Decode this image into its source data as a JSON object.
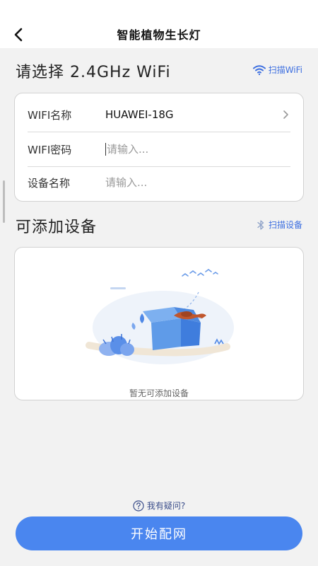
{
  "header": {
    "title": "智能植物生长灯"
  },
  "wifi_section": {
    "title": "请选择 2.4GHz WiFi",
    "scan_label": "扫描WiFi"
  },
  "form": {
    "wifi_name_label": "WIFI名称",
    "wifi_name_value": "HUAWEI-18G",
    "wifi_password_label": "WIFI密码",
    "wifi_password_placeholder": "请输入...",
    "device_name_label": "设备名称",
    "device_name_placeholder": "请输入..."
  },
  "device_section": {
    "title": "可添加设备",
    "scan_label": "扫描设备"
  },
  "empty_state": {
    "text": "暂无可添加设备"
  },
  "help": {
    "label": "我有疑问?"
  },
  "primary_button": {
    "label": "开始配网"
  },
  "colors": {
    "accent": "#4a86ef",
    "link": "#3d6fe0",
    "background": "#f2f2f2"
  }
}
